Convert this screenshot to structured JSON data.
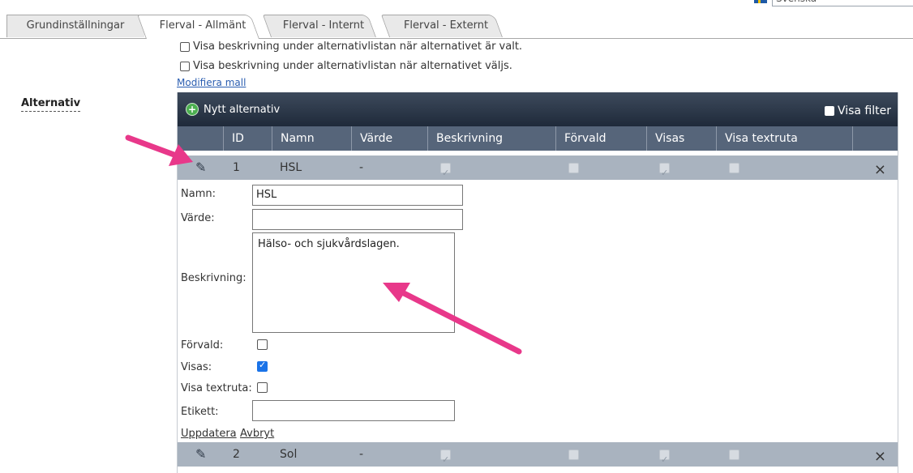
{
  "language": {
    "selected": "Svenska"
  },
  "tabs": [
    {
      "label": "Grundinställningar"
    },
    {
      "label": "Flerval - Allmänt"
    },
    {
      "label": "Flerval - Internt"
    },
    {
      "label": "Flerval - Externt"
    }
  ],
  "options": {
    "show_desc_selected": "Visa beskrivning under alternativlistan när alternativet är valt.",
    "show_desc_selecting": "Visa beskrivning under alternativlistan när alternativet väljs.",
    "edit_template": "Modifiera mall"
  },
  "section_label": "Alternativ",
  "grid": {
    "add_label": "Nytt alternativ",
    "filter_label": "Visa filter",
    "columns": [
      "ID",
      "Namn",
      "Värde",
      "Beskrivning",
      "Förvald",
      "Visas",
      "Visa textruta"
    ],
    "rows": [
      {
        "id": "1",
        "name": "HSL",
        "value": "-",
        "description": true,
        "default": false,
        "visible": true,
        "textbox": false
      },
      {
        "id": "2",
        "name": "Sol",
        "value": "-",
        "description": true,
        "default": false,
        "visible": true,
        "textbox": false
      }
    ]
  },
  "edit_form": {
    "name_label": "Namn:",
    "name_value": "HSL",
    "value_label": "Värde:",
    "value_value": "",
    "description_label": "Beskrivning:",
    "description_value": "Hälso- och sjukvårdslagen.",
    "default_label": "Förvald:",
    "visible_label": "Visas:",
    "textbox_label": "Visa textruta:",
    "tag_label": "Etikett:",
    "tag_value": "",
    "update_label": "Uppdatera",
    "cancel_label": "Avbryt"
  },
  "colors": {
    "arrow": "#e8388a",
    "toolbar": "#2b3647",
    "header": "#56657a",
    "row": "#a9b3bf"
  }
}
